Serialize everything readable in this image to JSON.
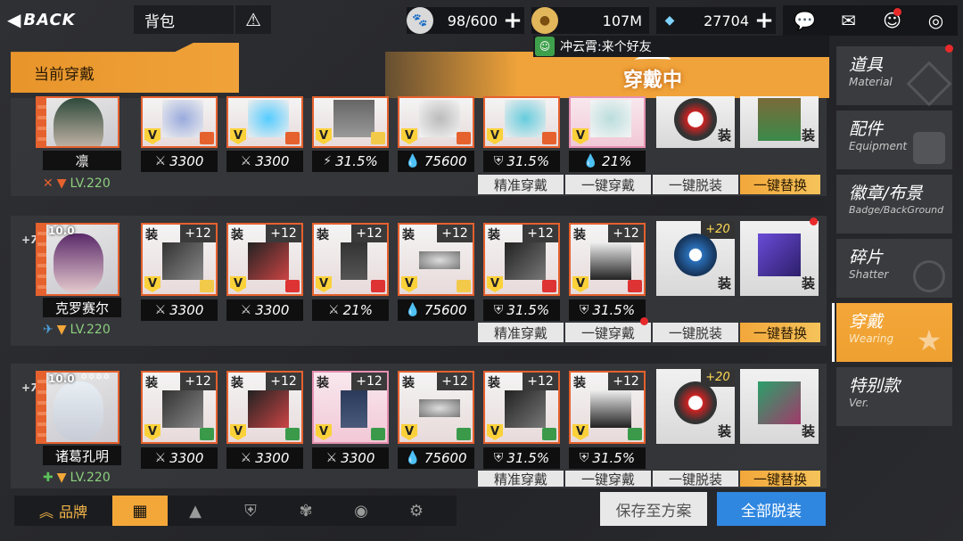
{
  "topbar": {
    "back_label": "BACK",
    "page_title": "背包",
    "stamina": "98/600",
    "gold": "107M",
    "diamonds": "27704"
  },
  "chat": {
    "message": "冲云霄:来个好友"
  },
  "banner": {
    "tab_label": "当前穿戴",
    "status": "穿戴中"
  },
  "rows": [
    {
      "name": "凛",
      "level": "LV.220",
      "stats": [
        "3300",
        "3300",
        "31.5%",
        "75600",
        "31.5%",
        "21%"
      ],
      "actions": [
        "精准穿戴",
        "一键穿戴",
        "一键脱装",
        "一键替换"
      ]
    },
    {
      "name": "克罗赛尔",
      "plus": "+72",
      "score": "10.0",
      "level": "LV.220",
      "enhance": "+12",
      "badge_enhance": "+20",
      "equip_tag": "装",
      "stats": [
        "3300",
        "3300",
        "21%",
        "75600",
        "31.5%",
        "31.5%"
      ],
      "actions": [
        "精准穿戴",
        "一键穿戴",
        "一键脱装",
        "一键替换"
      ]
    },
    {
      "name": "诸葛孔明",
      "plus": "+72",
      "score": "10.0",
      "level": "LV.220",
      "enhance": "+12",
      "badge_enhance": "+20",
      "equip_tag": "装",
      "stats": [
        "3300",
        "3300",
        "3300",
        "75600",
        "31.5%",
        "31.5%"
      ],
      "actions": [
        "精准穿戴",
        "一键穿戴",
        "一键脱装",
        "一键替换"
      ]
    }
  ],
  "nav": [
    {
      "zh": "道具",
      "en": "Material"
    },
    {
      "zh": "配件",
      "en": "Equipment"
    },
    {
      "zh": "徽章/布景",
      "en": "Badge/BackGround"
    },
    {
      "zh": "碎片",
      "en": "Shatter"
    },
    {
      "zh": "穿戴",
      "en": "Wearing"
    },
    {
      "zh": "特别款",
      "en": "Ver."
    }
  ],
  "bottom": {
    "brand_label": "品牌",
    "save_label": "保存至方案",
    "remove_all_label": "全部脱装"
  },
  "colors": {
    "accent": "#f4a739",
    "frame": "#e5612e",
    "blue": "#2f87e0"
  }
}
